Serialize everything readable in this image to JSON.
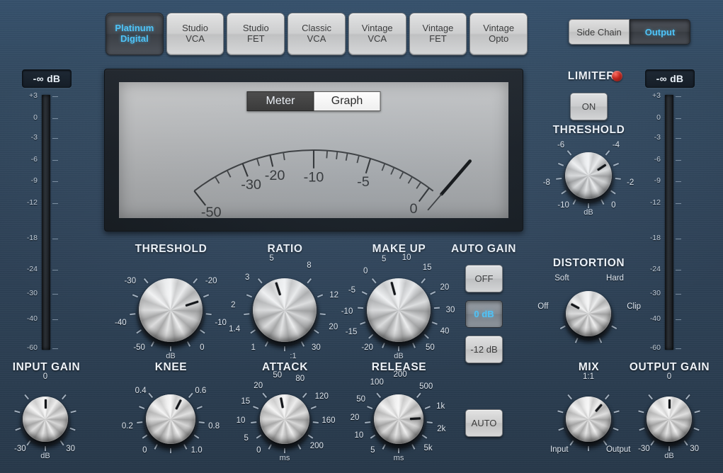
{
  "models": {
    "items": [
      {
        "line1": "Platinum",
        "line2": "Digital",
        "active": true
      },
      {
        "line1": "Studio",
        "line2": "VCA",
        "active": false
      },
      {
        "line1": "Studio",
        "line2": "FET",
        "active": false
      },
      {
        "line1": "Classic",
        "line2": "VCA",
        "active": false
      },
      {
        "line1": "Vintage",
        "line2": "VCA",
        "active": false
      },
      {
        "line1": "Vintage",
        "line2": "FET",
        "active": false
      },
      {
        "line1": "Vintage",
        "line2": "Opto",
        "active": false
      }
    ]
  },
  "view_toggle": {
    "side_chain": "Side Chain",
    "output": "Output",
    "active": "Output"
  },
  "meter_display": {
    "meter_label": "Meter",
    "graph_label": "Graph",
    "active": "Meter",
    "scale_labels": [
      "-50",
      "-30",
      "-20",
      "-10",
      "-5",
      "0"
    ],
    "needle_value": "0"
  },
  "input_meter": {
    "readout": "-∞ dB",
    "scale": [
      "+3",
      "0",
      "-3",
      "-6",
      "-9",
      "-12",
      "-18",
      "-24",
      "-30",
      "-40",
      "-60"
    ]
  },
  "output_meter": {
    "readout": "-∞ dB",
    "scale": [
      "+3",
      "0",
      "-3",
      "-6",
      "-9",
      "-12",
      "-18",
      "-24",
      "-30",
      "-40",
      "-60"
    ]
  },
  "input_gain": {
    "title": "INPUT GAIN",
    "unit": "dB",
    "min_label": "-30",
    "max_label": "30",
    "center_label": "0",
    "value_angle": 0
  },
  "threshold": {
    "title": "THRESHOLD",
    "unit": "dB",
    "labels": [
      "-50",
      "-40",
      "-30",
      "-20",
      "-10",
      "0"
    ],
    "value_angle": 72
  },
  "ratio": {
    "title": "RATIO",
    "unit": ":1",
    "labels": [
      "1",
      "1.4",
      "2",
      "3",
      "5",
      "8",
      "12",
      "20",
      "30"
    ],
    "value_angle": -18
  },
  "make_up": {
    "title": "MAKE UP",
    "unit": "dB",
    "labels": [
      "-20",
      "-15",
      "-10",
      "-5",
      "0",
      "5",
      "10",
      "15",
      "20",
      "30",
      "40",
      "50"
    ],
    "value_angle": -15
  },
  "auto_gain": {
    "title": "AUTO GAIN",
    "options": [
      {
        "label": "OFF",
        "active": false
      },
      {
        "label": "0 dB",
        "active": true
      },
      {
        "label": "-12 dB",
        "active": false
      }
    ],
    "auto_button": "AUTO"
  },
  "knee": {
    "title": "KNEE",
    "labels": [
      "0",
      "0.2",
      "0.4",
      "0.6",
      "0.8",
      "1.0"
    ],
    "value_angle": 27
  },
  "attack": {
    "title": "ATTACK",
    "unit": "ms",
    "labels": [
      "0",
      "5",
      "10",
      "15",
      "20",
      "50",
      "80",
      "120",
      "160",
      "200"
    ],
    "value_angle": -11
  },
  "release": {
    "title": "RELEASE",
    "unit": "ms",
    "labels": [
      "5",
      "10",
      "20",
      "50",
      "100",
      "200",
      "500",
      "1k",
      "2k",
      "5k"
    ],
    "value_angle": 87
  },
  "limiter": {
    "title": "LIMITER",
    "on_label": "ON",
    "on_active": false,
    "led_on": true,
    "threshold_title": "THRESHOLD",
    "threshold_unit": "dB",
    "threshold_labels": [
      "-10",
      "-8",
      "-6",
      "-4",
      "-2",
      "0"
    ],
    "threshold_angle": 57
  },
  "distortion": {
    "title": "DISTORTION",
    "labels": [
      "Off",
      "Soft",
      "Hard",
      "Clip"
    ],
    "value_angle": -62
  },
  "mix": {
    "title": "MIX",
    "top_label": "1:1",
    "left_label": "Input",
    "right_label": "Output",
    "value_angle": 41
  },
  "output_gain": {
    "title": "OUTPUT GAIN",
    "unit": "dB",
    "center_label": "0",
    "min_label": "-30",
    "max_label": "30",
    "value_angle": 0
  },
  "colors": {
    "accent": "#4fc3f7",
    "panel": "#2e4257",
    "led": "#c0241b"
  }
}
